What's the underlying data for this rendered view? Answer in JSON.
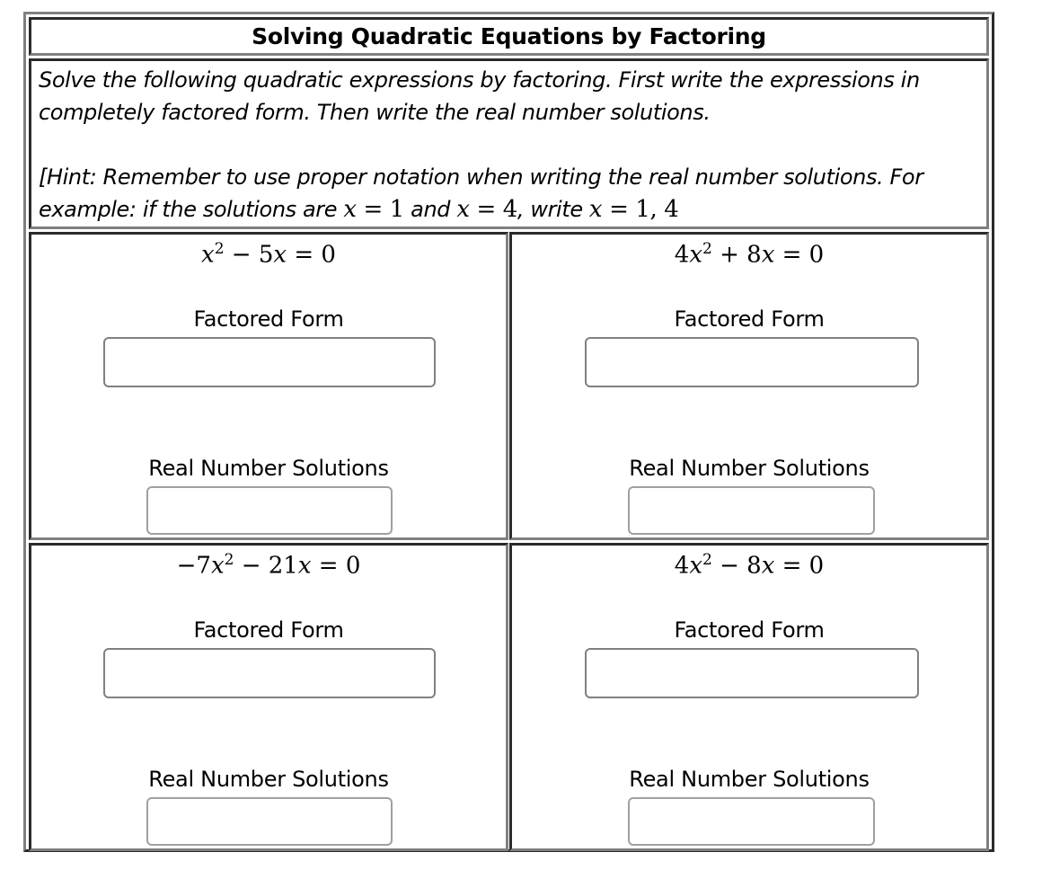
{
  "title": "Solving Quadratic Equations by Factoring",
  "instructions": {
    "line1": "Solve the following quadratic expressions by factoring. First write the expressions in",
    "line2": "completely factored form. Then write the real number solutions.",
    "hint_line1": "[Hint: Remember to use proper notation when writing the real number solutions. For",
    "hint_line2_prefix": "example: if the solutions are ",
    "hint_example_1": "x = 1",
    "hint_and": " and ",
    "hint_example_2": "x = 4",
    "hint_write": ", write ",
    "hint_example_3": "x = 1, 4"
  },
  "problems": [
    {
      "equation_html": "<i>x</i><sup>2</sup> &minus; 5<i>x</i> = 0",
      "factored_label": "Factored Form",
      "factored_value": "",
      "solutions_label": "Real Number Solutions",
      "solutions_value": ""
    },
    {
      "equation_html": "4<i>x</i><sup>2</sup> + 8<i>x</i> = 0",
      "factored_label": "Factored Form",
      "factored_value": "",
      "solutions_label": "Real Number Solutions",
      "solutions_value": ""
    },
    {
      "equation_html": "&minus;7<i>x</i><sup>2</sup> &minus; 21<i>x</i> = 0",
      "factored_label": "Factored Form",
      "factored_value": "",
      "solutions_label": "Real Number Solutions",
      "solutions_value": ""
    },
    {
      "equation_html": "4<i>x</i><sup>2</sup> &minus; 8<i>x</i> = 0",
      "factored_label": "Factored Form",
      "factored_value": "",
      "solutions_label": "Real Number Solutions",
      "solutions_value": ""
    }
  ]
}
